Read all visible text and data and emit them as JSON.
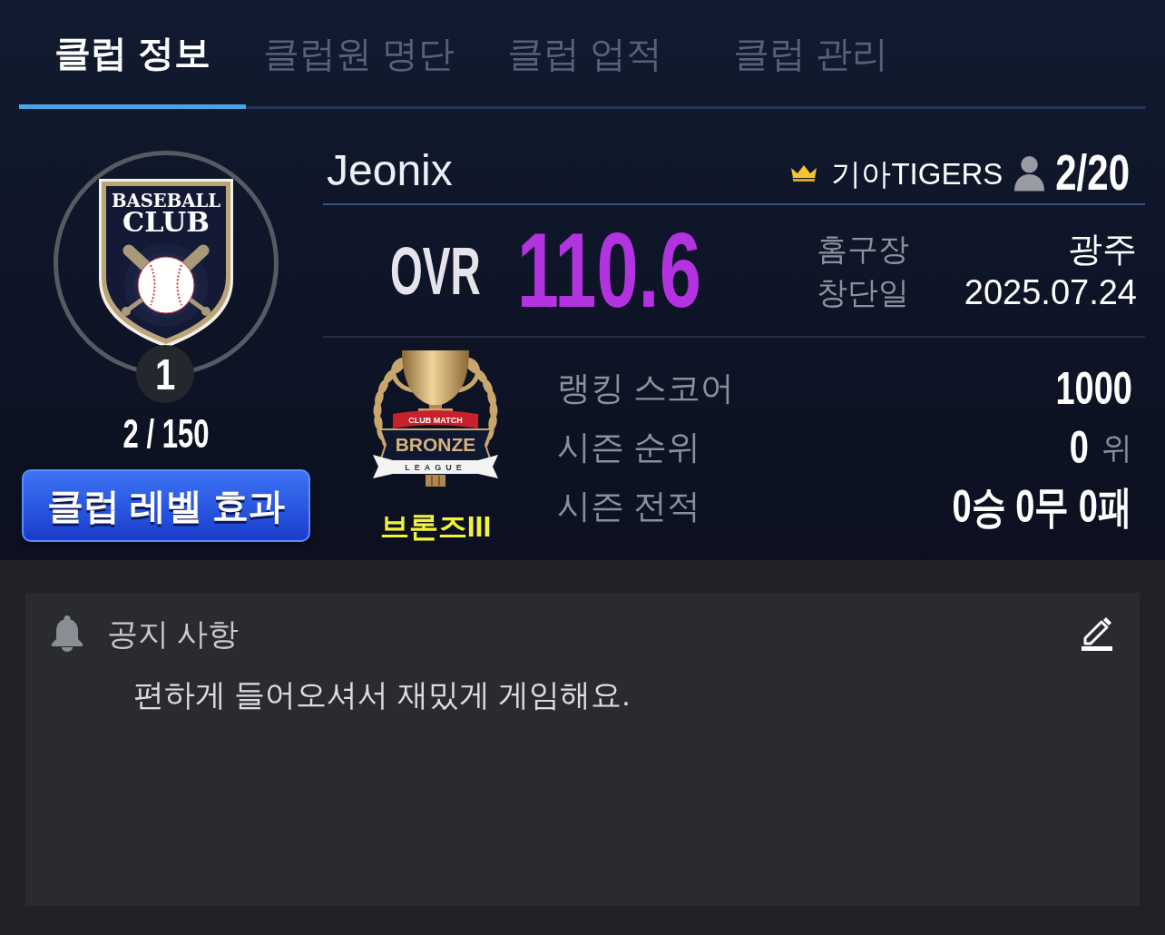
{
  "tabs": [
    {
      "label": "클럽 정보",
      "selected": true
    },
    {
      "label": "클럽원 명단",
      "selected": false
    },
    {
      "label": "클럽 업적",
      "selected": false
    },
    {
      "label": "클럽 관리",
      "selected": false
    }
  ],
  "club": {
    "emblem_text": [
      "BASEBALL",
      "CLUB"
    ],
    "level": "1",
    "exp": "2 / 150",
    "level_button": "클럽 레벨 효과",
    "name": "Jeonix",
    "leader": "기아TIGERS",
    "members": "2/20",
    "ovr_label": "OVR",
    "ovr": "110.6",
    "details": [
      {
        "label": "홈구장",
        "value": "광주"
      },
      {
        "label": "창단일",
        "value": "2025.07.24"
      }
    ]
  },
  "league": {
    "badge": {
      "top": "CLUB MATCH",
      "main": "BRONZE",
      "bottom": "LEAGUE"
    },
    "tier": "브론즈III",
    "stats": [
      {
        "label": "랭킹 스코어",
        "value": "1000"
      },
      {
        "label": "시즌 순위",
        "value": "0",
        "unit": "위"
      },
      {
        "label": "시즌 전적",
        "value": "0승 0무 0패"
      }
    ]
  },
  "notice": {
    "title": "공지 사항",
    "message": "편하게 들어오셔서 재밌게 게임해요."
  }
}
